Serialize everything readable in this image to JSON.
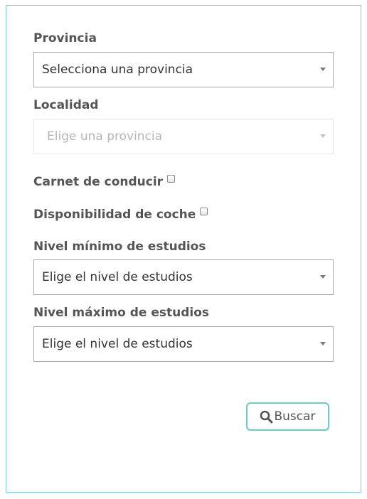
{
  "form": {
    "provincia": {
      "label": "Provincia",
      "selected": "Selecciona una provincia"
    },
    "localidad": {
      "label": "Localidad",
      "selected": "Elige una provincia"
    },
    "carnet": {
      "label": "Carnet de conducir",
      "checked": false
    },
    "coche": {
      "label": "Disponibilidad de coche",
      "checked": false
    },
    "nivel_minimo": {
      "label": "Nivel mínimo de estudios",
      "selected": "Elige el nivel de estudios"
    },
    "nivel_maximo": {
      "label": "Nivel máximo de estudios",
      "selected": "Elige el nivel de estudios"
    },
    "search_button": {
      "label": "Buscar",
      "icon": "search-icon"
    }
  },
  "colors": {
    "panel_border": "#7fcfcf",
    "button_border": "#66cccc",
    "text": "#555555"
  }
}
